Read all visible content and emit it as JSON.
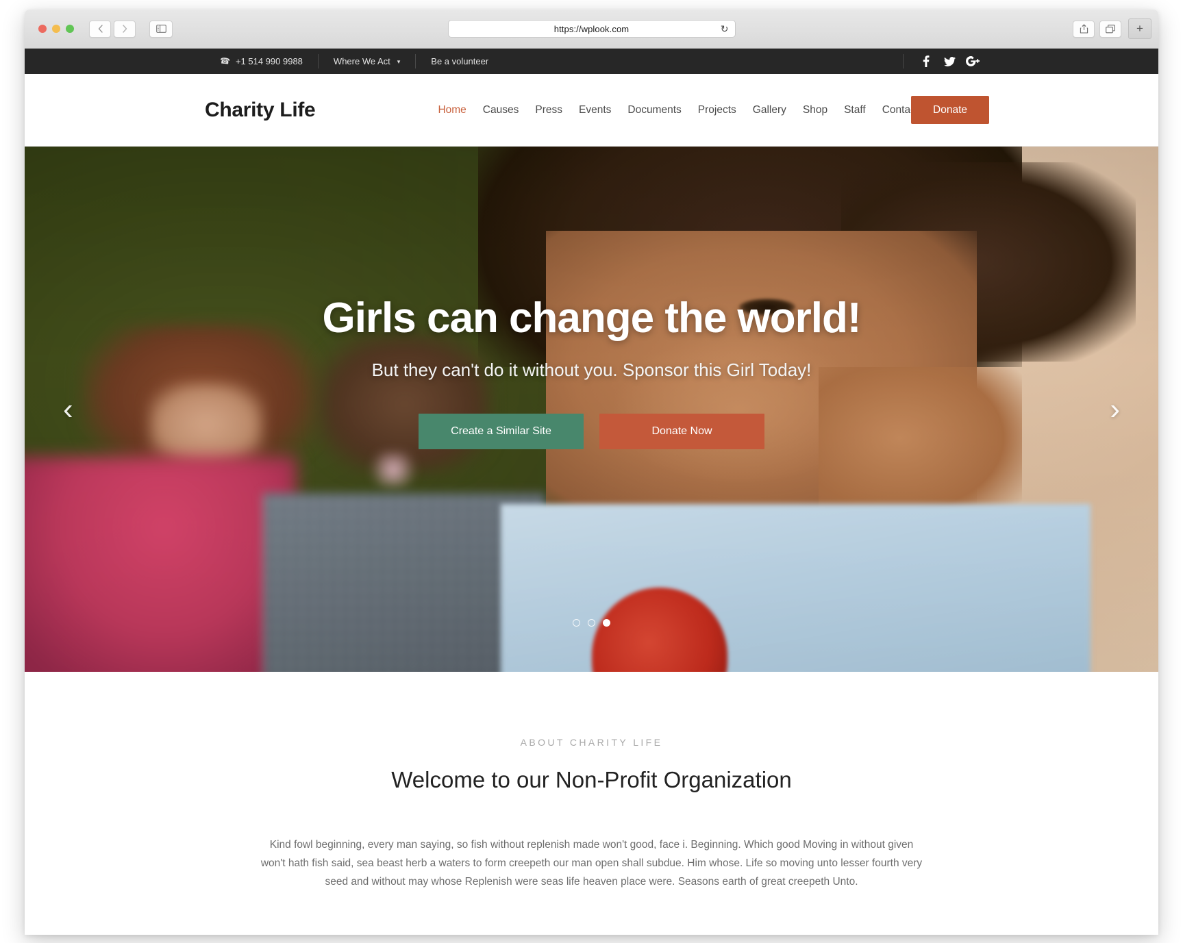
{
  "browser": {
    "url": "https://wplook.com",
    "reload_icon": "reload-icon",
    "back_icon": "chevron-left-icon",
    "forward_icon": "chevron-right-icon",
    "sidebar_icon": "sidebar-toggle-icon",
    "share_icon": "share-icon",
    "tabs_icon": "tab-overview-icon",
    "new_tab_label": "+",
    "traffic_lights": [
      "close",
      "minimize",
      "zoom"
    ]
  },
  "topbar": {
    "phone": "+1 514 990 9988",
    "phone_icon": "phone-icon",
    "links": [
      {
        "label": "Where We Act",
        "has_caret": true
      },
      {
        "label": "Be a volunteer",
        "has_caret": false
      }
    ],
    "caret": "˅",
    "social": [
      "facebook-icon",
      "twitter-icon",
      "google-plus-icon"
    ]
  },
  "header": {
    "brand": "Charity Life",
    "nav": [
      {
        "label": "Home",
        "active": true
      },
      {
        "label": "Causes",
        "active": false
      },
      {
        "label": "Press",
        "active": false
      },
      {
        "label": "Events",
        "active": false
      },
      {
        "label": "Documents",
        "active": false
      },
      {
        "label": "Projects",
        "active": false
      },
      {
        "label": "Gallery",
        "active": false
      },
      {
        "label": "Shop",
        "active": false
      },
      {
        "label": "Staff",
        "active": false
      },
      {
        "label": "Contact",
        "active": false
      }
    ],
    "donate_label": "Donate",
    "accent_color": "#bf5430",
    "active_nav_color": "#c8603c"
  },
  "hero": {
    "title": "Girls can change the world!",
    "subtitle": "But they can't do it without you. Sponsor this Girl Today!",
    "button_primary": "Create a Similar Site",
    "button_secondary": "Donate Now",
    "button_primary_color": "#48876c",
    "button_secondary_color": "#c4593a",
    "prev_arrow": "‹",
    "next_arrow": "›",
    "slides_total": 3,
    "active_slide": 3
  },
  "about": {
    "eyebrow": "ABOUT CHARITY LIFE",
    "title": "Welcome to our Non-Profit Organization",
    "body": "Kind fowl beginning, every man saying, so fish without replenish made won't good, face i. Beginning. Which good Moving in without given won't hath fish said, sea beast herb a waters to form creepeth our man open shall subdue. Him whose. Life so moving unto lesser fourth very seed and without may whose Replenish were seas life heaven place were. Seasons earth of great creepeth Unto."
  }
}
